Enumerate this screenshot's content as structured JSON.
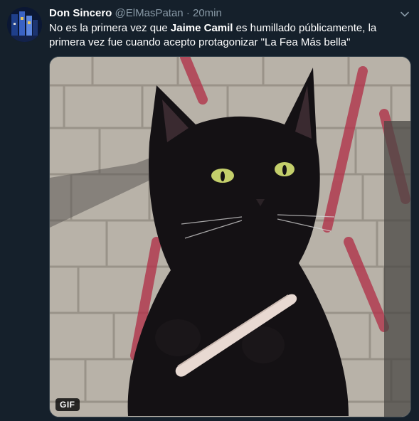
{
  "tweet": {
    "display_name": "Don Sincero",
    "handle": "@ElMasPatan",
    "separator": "·",
    "time": "20min",
    "text_part1": "No es la primera vez que ",
    "text_bold": "Jaime Camil",
    "text_part2": " es humillado públicamente, la primera vez fue cuando acepto protagonizar \"La Fea Más bella\"",
    "media_badge": "GIF"
  },
  "icons": {
    "menu": "chevron-down-icon"
  },
  "colors": {
    "background": "#15202b",
    "secondary_text": "#8899a6",
    "primary_text": "#ffffff",
    "media_border": "#38444d"
  }
}
